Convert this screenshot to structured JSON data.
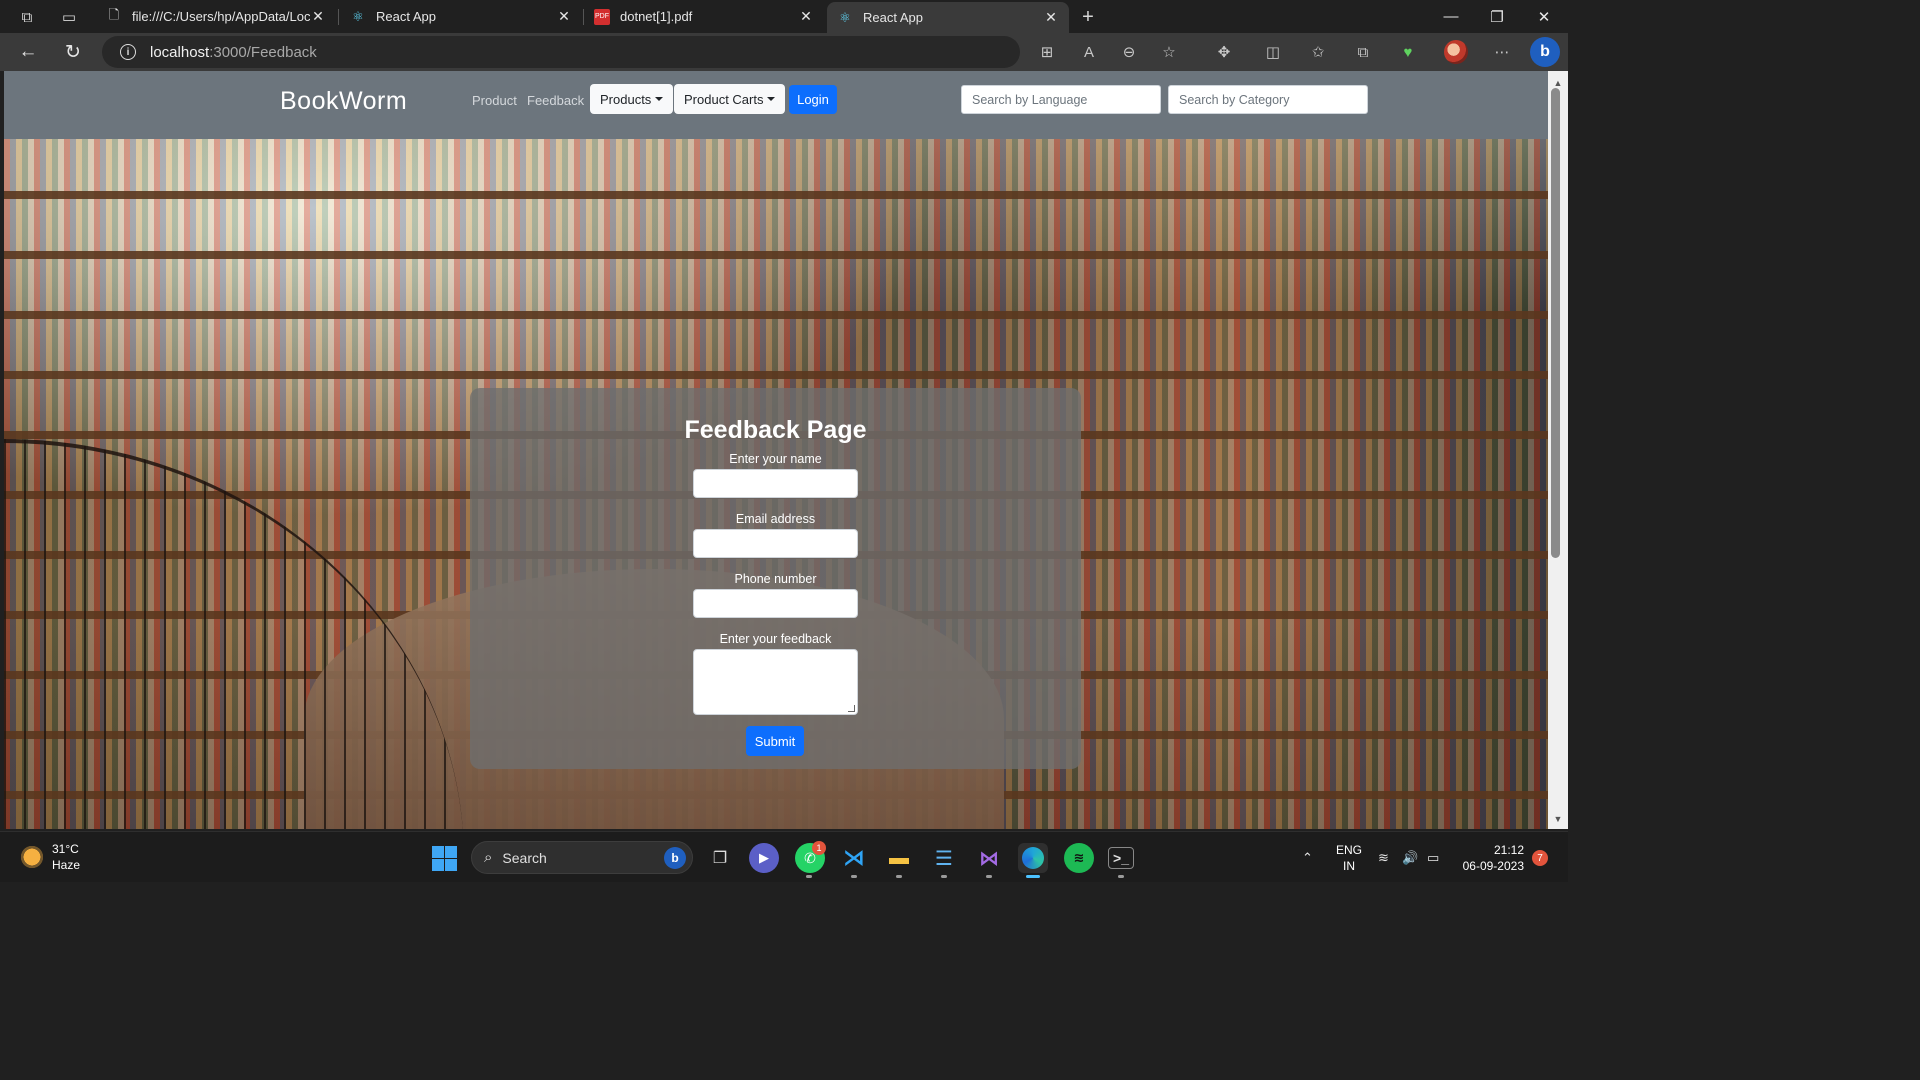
{
  "browser": {
    "tabs": [
      {
        "title": "file:///C:/Users/hp/AppData/Loca",
        "icon": "file-pdf-icon",
        "active": false
      },
      {
        "title": "React App",
        "icon": "react-icon",
        "active": false
      },
      {
        "title": "dotnet[1].pdf",
        "icon": "pdf-icon",
        "active": false
      },
      {
        "title": "React App",
        "icon": "react-icon",
        "active": true
      }
    ],
    "url_host": "localhost",
    "url_path": ":3000/Feedback"
  },
  "navbar": {
    "brand": "BookWorm",
    "links": [
      "Product",
      "Feedback"
    ],
    "products_dropdown": "Products",
    "carts_dropdown": "Product Carts",
    "login": "Login",
    "search_language_placeholder": "Search by Language",
    "search_category_placeholder": "Search by Category"
  },
  "feedback_form": {
    "title": "Feedback Page",
    "name_label": "Enter your name",
    "email_label": "Email address",
    "phone_label": "Phone number",
    "feedback_label": "Enter your feedback",
    "name_value": "",
    "email_value": "",
    "phone_value": "",
    "feedback_value": "",
    "submit": "Submit"
  },
  "taskbar": {
    "weather_temp": "31°C",
    "weather_desc": "Haze",
    "search_label": "Search",
    "whatsapp_badge": "1",
    "lang_line1": "ENG",
    "lang_line2": "IN",
    "time": "21:12",
    "date": "06-09-2023",
    "notifications": "7"
  },
  "colors": {
    "navbar_bg": "#6c757d",
    "primary": "#0d6efd",
    "card_bg": "rgba(110,110,110,0.78)"
  }
}
